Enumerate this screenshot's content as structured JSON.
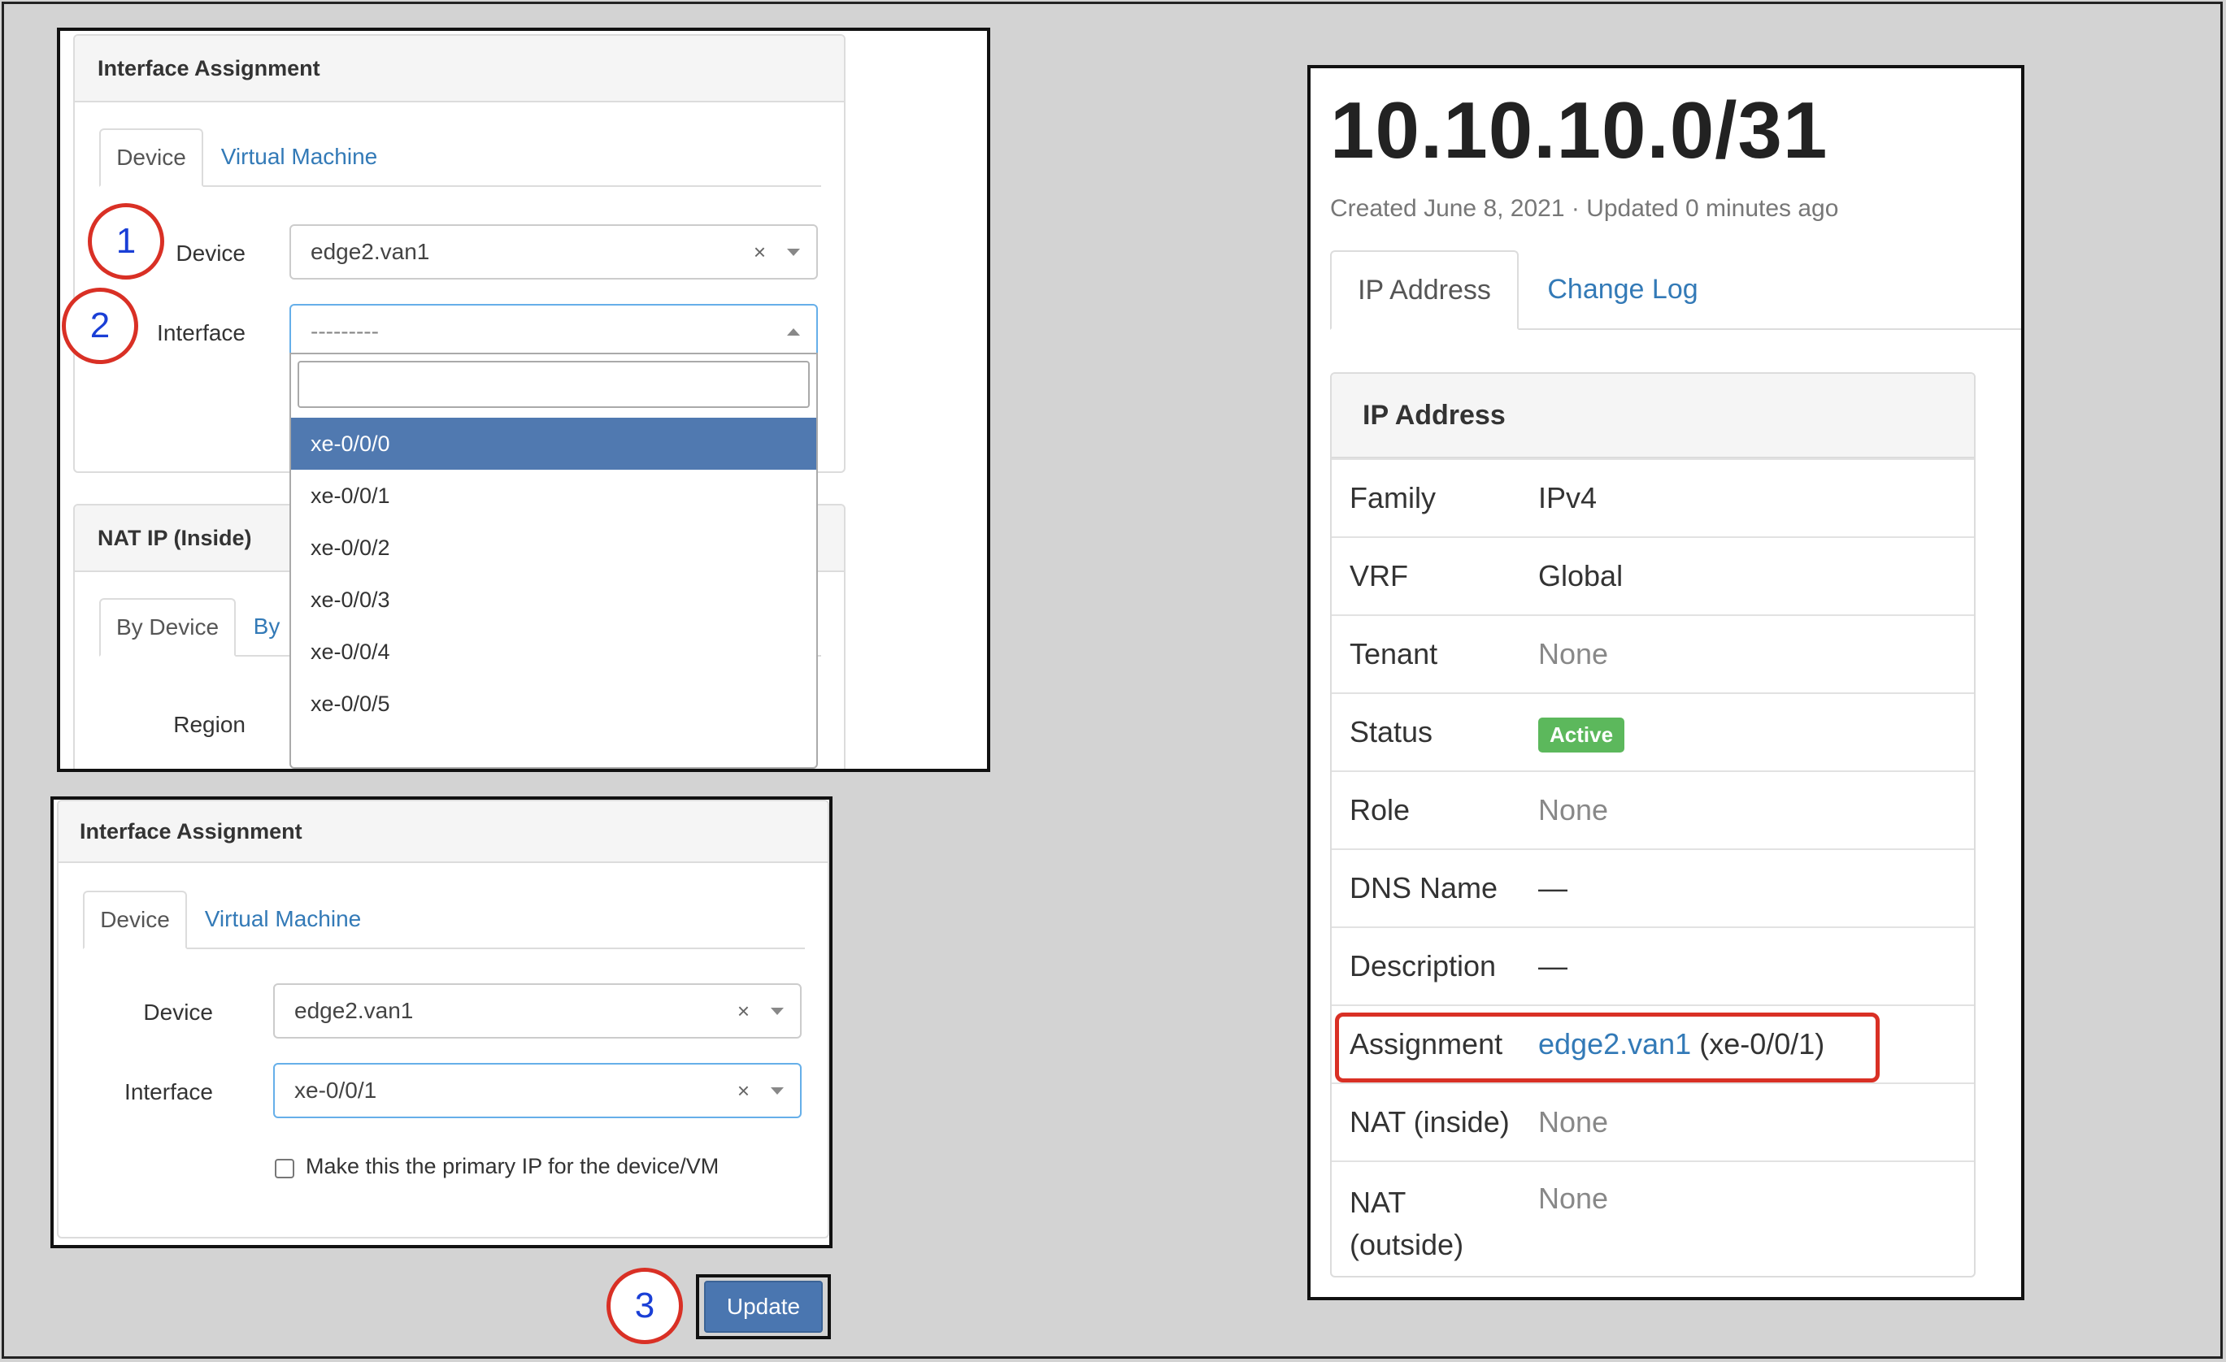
{
  "form1": {
    "header": "Interface Assignment",
    "tabs": [
      "Device",
      "Virtual Machine"
    ],
    "device_label": "Device",
    "device_value": "edge2.van1",
    "interface_label": "Interface",
    "interface_value": "---------",
    "options": [
      "xe-0/0/0",
      "xe-0/0/1",
      "xe-0/0/2",
      "xe-0/0/3",
      "xe-0/0/4",
      "xe-0/0/5"
    ],
    "nat_header": "NAT IP (Inside)",
    "nat_tabs": [
      "By Device",
      "By"
    ],
    "region_label": "Region",
    "clear_icon": "×"
  },
  "form2": {
    "header": "Interface Assignment",
    "tabs": [
      "Device",
      "Virtual Machine"
    ],
    "device_label": "Device",
    "device_value": "edge2.van1",
    "interface_label": "Interface",
    "interface_value": "xe-0/0/1",
    "checkbox_label": "Make this the primary IP for the device/VM",
    "clear_icon": "×"
  },
  "steps": [
    "1",
    "2",
    "3"
  ],
  "update_button": "Update",
  "detail": {
    "title": "10.10.10.0/31",
    "meta": "Created June 8, 2021 · Updated 0 minutes ago",
    "tabs": [
      "IP Address",
      "Change Log"
    ],
    "panel_header": "IP Address",
    "rows": [
      {
        "key": "Family",
        "value": "IPv4"
      },
      {
        "key": "VRF",
        "value": "Global"
      },
      {
        "key": "Tenant",
        "value": "None"
      },
      {
        "key": "Status",
        "value": "Active"
      },
      {
        "key": "Role",
        "value": "None"
      },
      {
        "key": "DNS Name",
        "value": "—"
      },
      {
        "key": "Description",
        "value": "—"
      },
      {
        "key": "Assignment",
        "link": "edge2.van1",
        "value": "(xe-0/0/1)"
      },
      {
        "key": "NAT (inside)",
        "value": "None"
      },
      {
        "key": "NAT (outside)",
        "value": "None"
      }
    ]
  },
  "colors": {
    "accent": "#337ab7",
    "highlight": "#5079b0",
    "annotation": "#d93025",
    "active_badge": "#5cb85c"
  }
}
